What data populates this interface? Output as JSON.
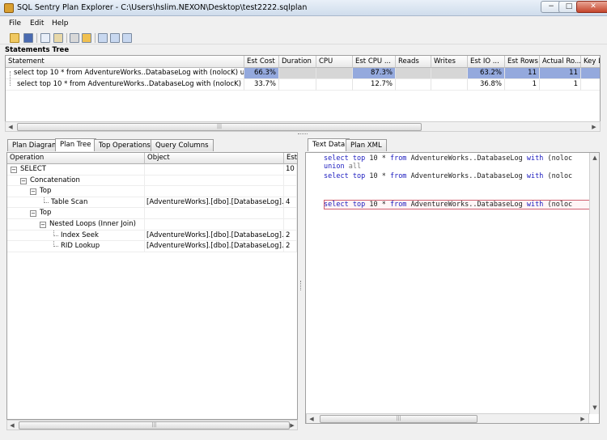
{
  "window": {
    "title": "SQL Sentry Plan Explorer - C:\\Users\\hslim.NEXON\\Desktop\\test2222.sqlplan",
    "minimize": "−",
    "maximize": "□",
    "close": "✕"
  },
  "menu": [
    "File",
    "Edit",
    "Help"
  ],
  "statements": {
    "label": "Statements Tree",
    "columns": [
      "Statement",
      "Est Cost",
      "Duration",
      "CPU",
      "Est CPU ...",
      "Reads",
      "Writes",
      "Est IO ...",
      "Est Rows",
      "Actual Ro...",
      "Key L"
    ],
    "rows": [
      {
        "statement": "select top 10 * from AdventureWorks..DatabaseLog with (nolocK) uni...",
        "est_cost": "66.3%",
        "duration": "",
        "cpu": "",
        "est_cpu": "87.3%",
        "reads": "",
        "writes": "",
        "est_io": "63.2%",
        "est_rows": "11",
        "actual_rows": "11",
        "key": ""
      },
      {
        "statement": "select top 10 * from AdventureWorks..DatabaseLog with (nolocK) wh...",
        "est_cost": "33.7%",
        "duration": "",
        "cpu": "",
        "est_cpu": "12.7%",
        "reads": "",
        "writes": "",
        "est_io": "36.8%",
        "est_rows": "1",
        "actual_rows": "1",
        "key": ""
      }
    ],
    "scroll_grip": "|||"
  },
  "left_tabs": [
    "Plan Diagram",
    "Plan Tree",
    "Top Operations",
    "Query Columns"
  ],
  "right_tabs": [
    "Text Data",
    "Plan XML"
  ],
  "plan_tree": {
    "columns": [
      "Operation",
      "Object",
      "Est"
    ],
    "rows": [
      {
        "op": "SELECT",
        "obj": "",
        "est": "10"
      },
      {
        "op": "Concatenation",
        "obj": "",
        "est": ""
      },
      {
        "op": "Top",
        "obj": "",
        "est": ""
      },
      {
        "op": "Table Scan",
        "obj": "[AdventureWorks].[dbo].[DatabaseLog].(...",
        "est": "4"
      },
      {
        "op": "Top",
        "obj": "",
        "est": ""
      },
      {
        "op": "Nested Loops (Inner Join)",
        "obj": "",
        "est": ""
      },
      {
        "op": "Index Seek",
        "obj": "[AdventureWorks].[dbo].[DatabaseLog].[...",
        "est": "2"
      },
      {
        "op": "RID Lookup",
        "obj": "[AdventureWorks].[dbo].[DatabaseLog].[...",
        "est": "2"
      }
    ],
    "scroll_grip": "|||"
  },
  "text_data": {
    "line1": {
      "kw1": "select",
      "kw2": "top",
      "num": "10",
      "mid": "*",
      "kw3": "from",
      "obj": "AdventureWorks..DatabaseLog",
      "kw4": "with",
      "tail": "(noloc"
    },
    "line2": {
      "kw1": "union",
      "gy": "all"
    },
    "line3": {
      "kw1": "select",
      "kw2": "top",
      "num": "10",
      "mid": "*",
      "kw3": "from",
      "obj": "AdventureWorks..DatabaseLog",
      "kw4": "with",
      "tail": "(noloc"
    },
    "line4": {
      "kw1": "select",
      "kw2": "top",
      "num": "10",
      "mid": "*",
      "kw3": "from",
      "obj": "AdventureWorks..DatabaseLog",
      "kw4": "with",
      "tail": "(noloc"
    },
    "scroll_grip": "|||"
  },
  "colors": {
    "highlight_bar": "#94a9dd",
    "empty_cell": "#d6d6d6",
    "keyword": "#2020c0",
    "current_line_border": "#d06070"
  }
}
